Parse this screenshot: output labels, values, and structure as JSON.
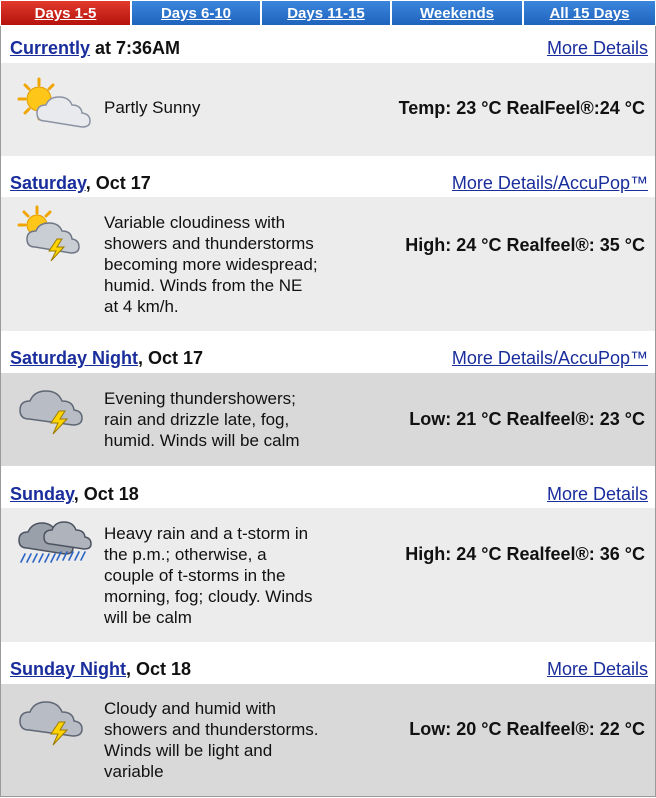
{
  "tabs": [
    {
      "label": "Days 1-5",
      "active": true
    },
    {
      "label": "Days 6-10",
      "active": false
    },
    {
      "label": "Days 11-15",
      "active": false
    },
    {
      "label": "Weekends",
      "active": false
    },
    {
      "label": "All 15 Days",
      "active": false
    }
  ],
  "current": {
    "title": "Currently",
    "time": " at 7:36AM",
    "more": "More Details",
    "condition": "Partly Sunny",
    "temp": "Temp: 23 °C RealFeel®:24 °C",
    "icon": "partly-sunny-icon"
  },
  "periods": [
    {
      "title": "Saturday",
      "date": ", Oct 17",
      "more": "More Details/AccuPop™",
      "desc_lines": [
        "Variable cloudiness with",
        "showers and thunderstorms",
        "becoming more widespread;",
        "humid. Winds from the NE",
        "at 4 km/h."
      ],
      "temp": "High: 24 °C Realfeel®: 35 °C",
      "icon": "sun-cloud-thunderstorm-icon"
    },
    {
      "title": "Saturday Night",
      "date": ", Oct 17",
      "more": "More Details/AccuPop™",
      "desc_lines": [
        "Evening thundershowers;",
        "rain and drizzle late, fog,",
        "humid. Winds will be calm"
      ],
      "temp": "Low: 21 °C Realfeel®: 23 °C",
      "icon": "cloud-thunderstorm-icon"
    },
    {
      "title": "Sunday",
      "date": ", Oct 18",
      "more": "More Details",
      "desc_lines": [
        "Heavy rain and a t-storm in",
        "the p.m.; otherwise, a",
        "couple of t-storms in the",
        "morning, fog; cloudy. Winds",
        "will be calm"
      ],
      "temp": "High: 24 °C Realfeel®: 36 °C",
      "icon": "heavy-rain-icon"
    },
    {
      "title": "Sunday Night",
      "date": ", Oct 18",
      "more": "More Details",
      "desc_lines": [
        "Cloudy and humid with",
        "showers and thunderstorms.",
        "Winds will be light and",
        "variable"
      ],
      "temp": "Low: 20 °C Realfeel®: 22 °C",
      "icon": "cloud-thunderstorm-icon"
    }
  ]
}
